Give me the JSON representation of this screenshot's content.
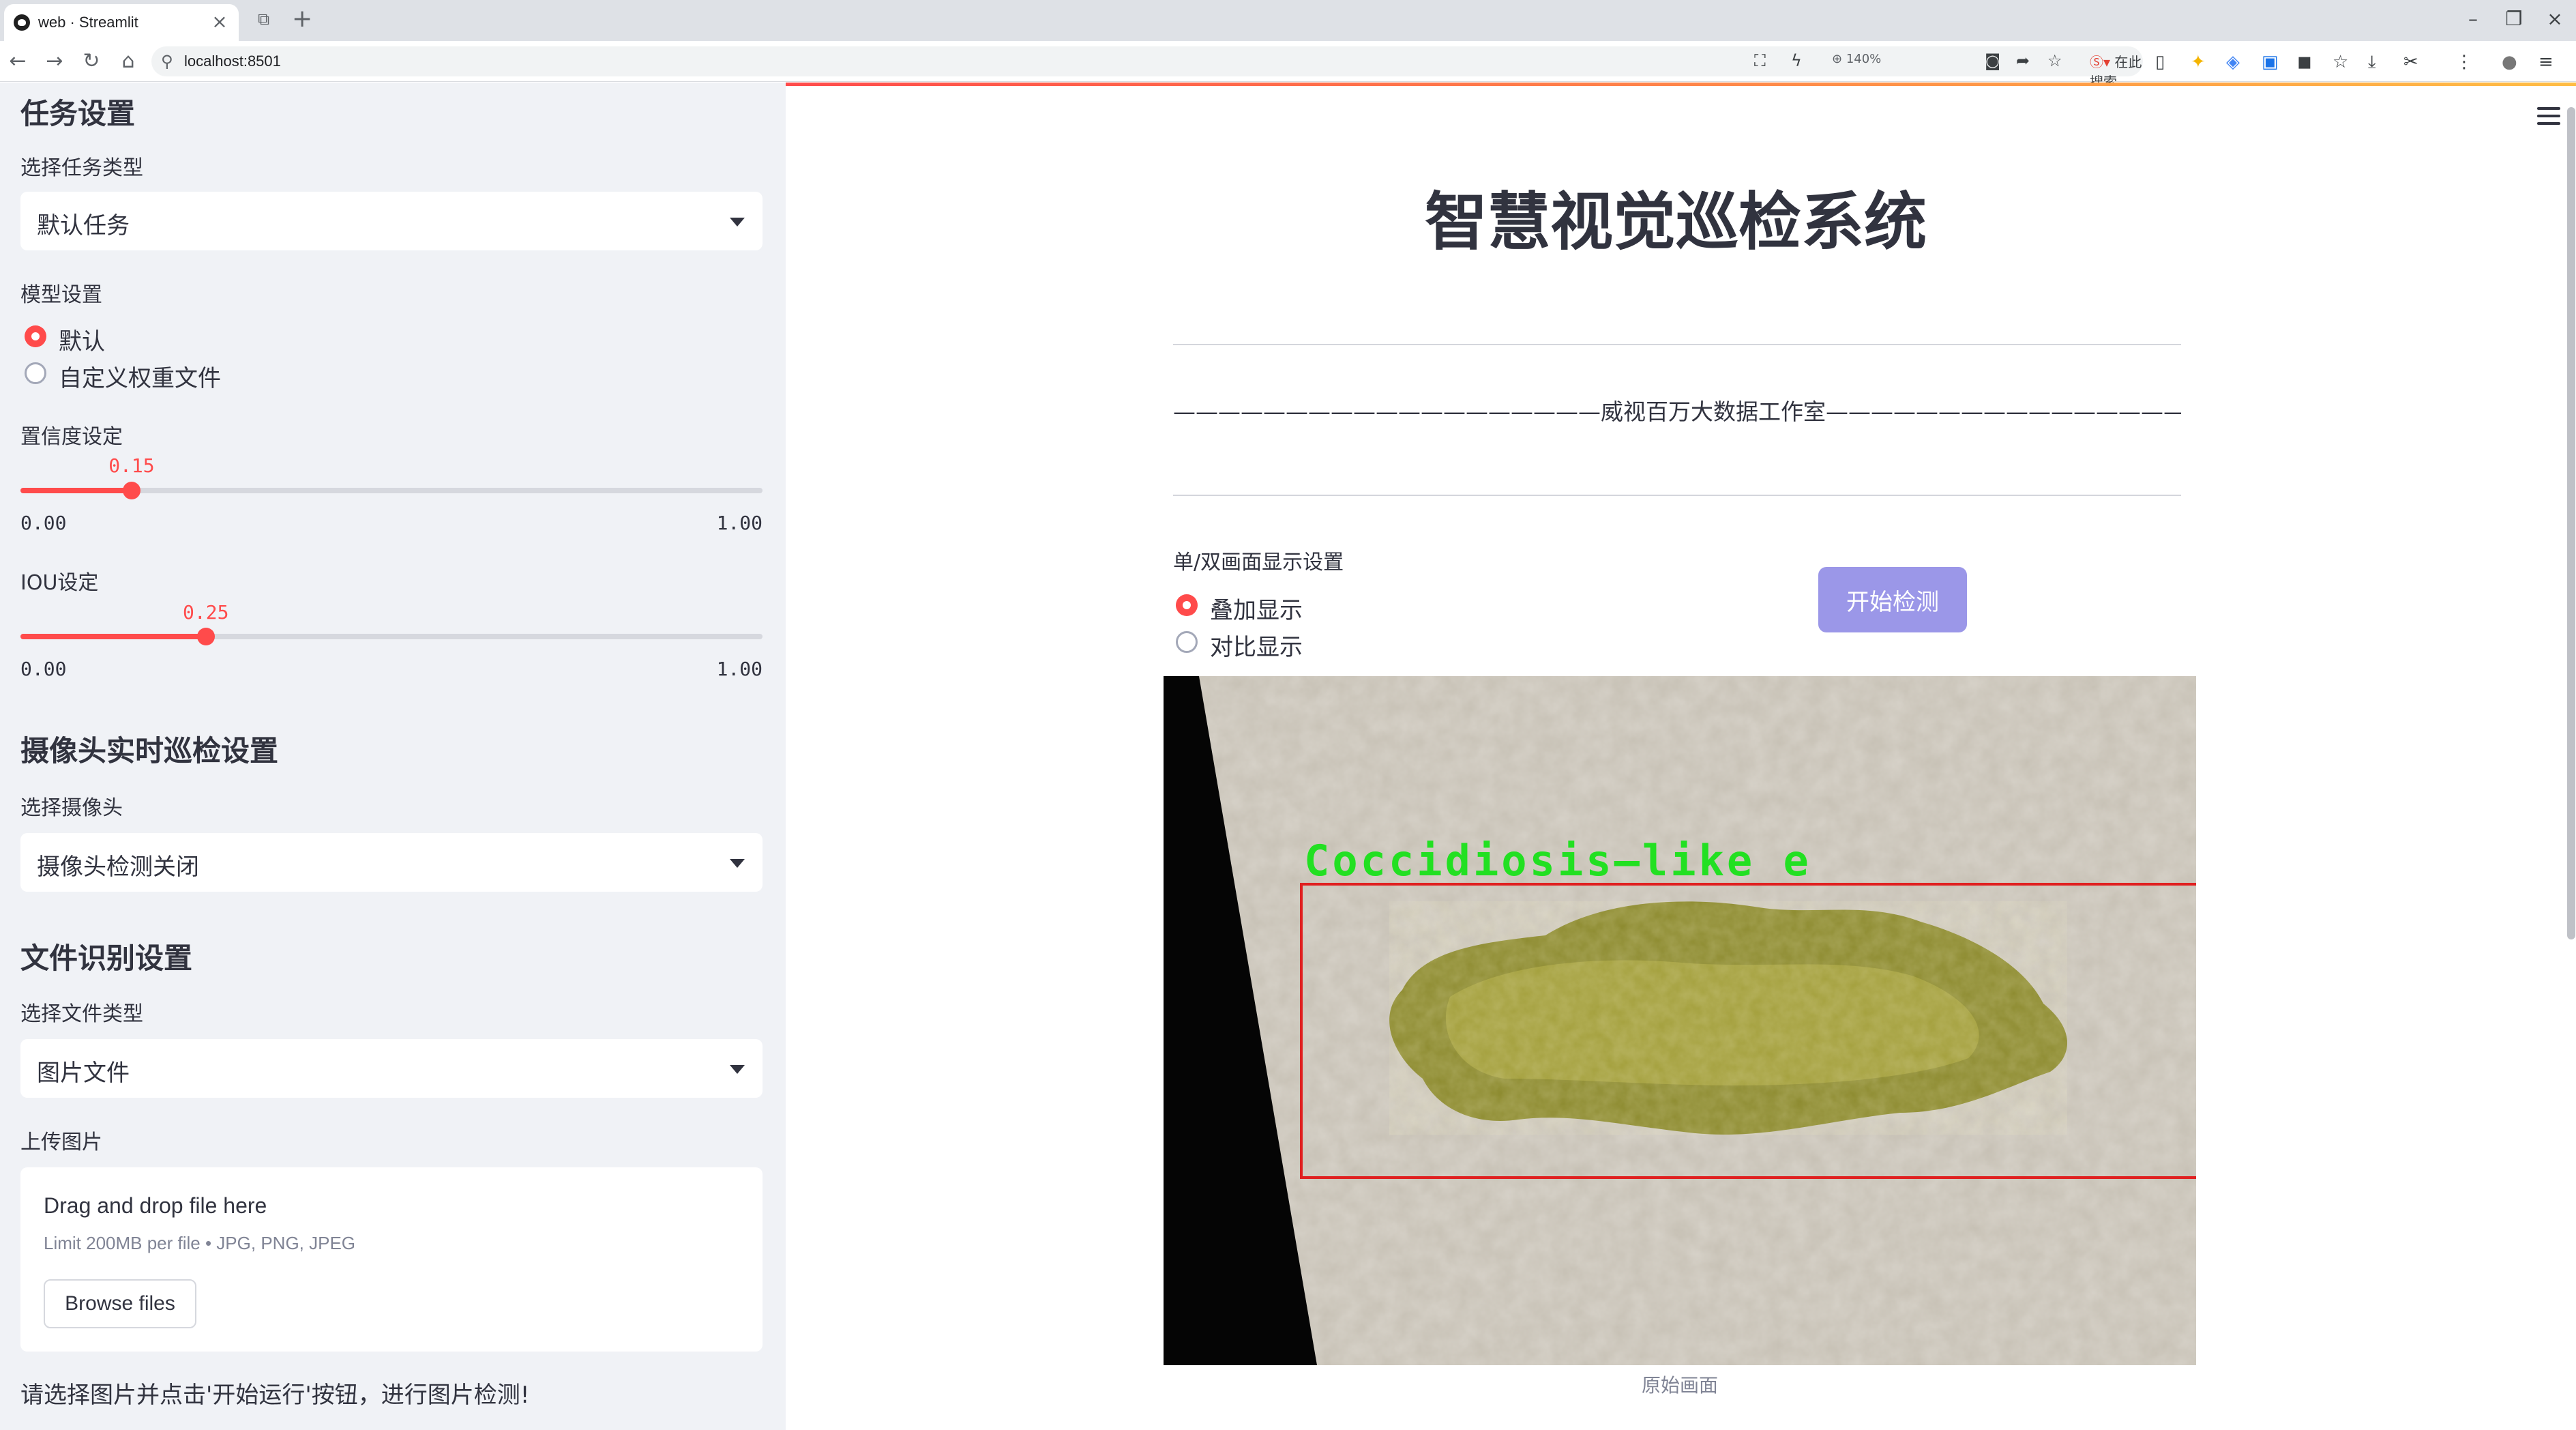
{
  "browser": {
    "tab_title": "web · Streamlit",
    "url": "localhost:8501",
    "zoom": "140%",
    "search_placeholder": "在此搜索"
  },
  "sidebar": {
    "task_section_title": "任务设置",
    "task_type_label": "选择任务类型",
    "task_type_value": "默认任务",
    "model_label": "模型设置",
    "model_options": [
      "默认",
      "自定义权重文件"
    ],
    "model_selected": "默认",
    "confidence": {
      "label": "置信度设定",
      "value": "0.15",
      "min": "0.00",
      "max": "1.00",
      "fraction": 0.15
    },
    "iou": {
      "label": "IOU设定",
      "value": "0.25",
      "min": "0.00",
      "max": "1.00",
      "fraction": 0.25
    },
    "camera_section_title": "摄像头实时巡检设置",
    "camera_label": "选择摄像头",
    "camera_value": "摄像头检测关闭",
    "file_section_title": "文件识别设置",
    "file_type_label": "选择文件类型",
    "file_type_value": "图片文件",
    "upload_label": "上传图片",
    "uploader": {
      "drop_text": "Drag and drop file here",
      "limit_text": "Limit 200MB per file • JPG, PNG, JPEG",
      "browse_label": "Browse files"
    },
    "hint": "请选择图片并点击'开始运行'按钮，进行图片检测!"
  },
  "main": {
    "title": "智慧视觉巡检系统",
    "subtitle": "———————————————————威视百万大数据工作室———————————————————",
    "display_label": "单/双画面显示设置",
    "display_options": [
      "叠加显示",
      "对比显示"
    ],
    "display_selected": "叠加显示",
    "start_button": "开始检测",
    "detection_label": "Coccidiosis—like  e",
    "image_caption": "原始画面"
  },
  "colors": {
    "accent": "#ff4b4b",
    "sidebar_bg": "#f0f2f6",
    "start_button": "#9b97e8",
    "detection_box": "#e02020",
    "detection_text": "#22e022"
  }
}
